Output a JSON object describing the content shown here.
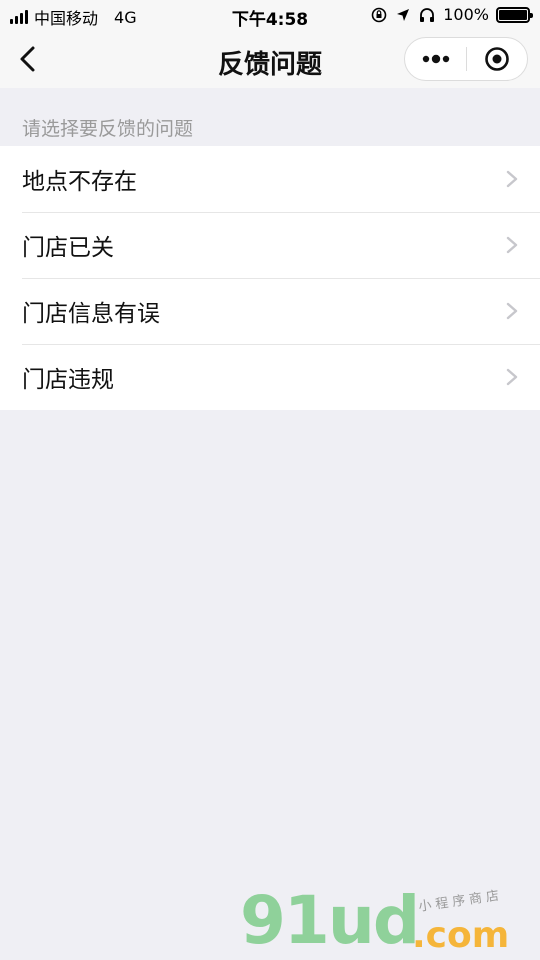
{
  "status_bar": {
    "carrier": "中国移动",
    "network": "4G",
    "time": "下午4:58",
    "battery": "100%"
  },
  "nav": {
    "title": "反馈问题",
    "back_icon": "chevron-left-icon",
    "more_icon": "more-dots-icon",
    "close_icon": "target-close-icon"
  },
  "section": {
    "label": "请选择要反馈的问题"
  },
  "items": [
    {
      "label": "地点不存在"
    },
    {
      "label": "门店已关"
    },
    {
      "label": "门店信息有误"
    },
    {
      "label": "门店违规"
    }
  ],
  "watermark": {
    "brand": "91ud",
    "domain": ".com",
    "tagline": "小程序商店"
  },
  "colors": {
    "background": "#efeff4",
    "list_bg": "#ffffff",
    "secondary_text": "#9a9a9a",
    "chevron": "#c7c7cc",
    "watermark_green": "#8fd19a",
    "watermark_orange": "#f5b53a"
  }
}
